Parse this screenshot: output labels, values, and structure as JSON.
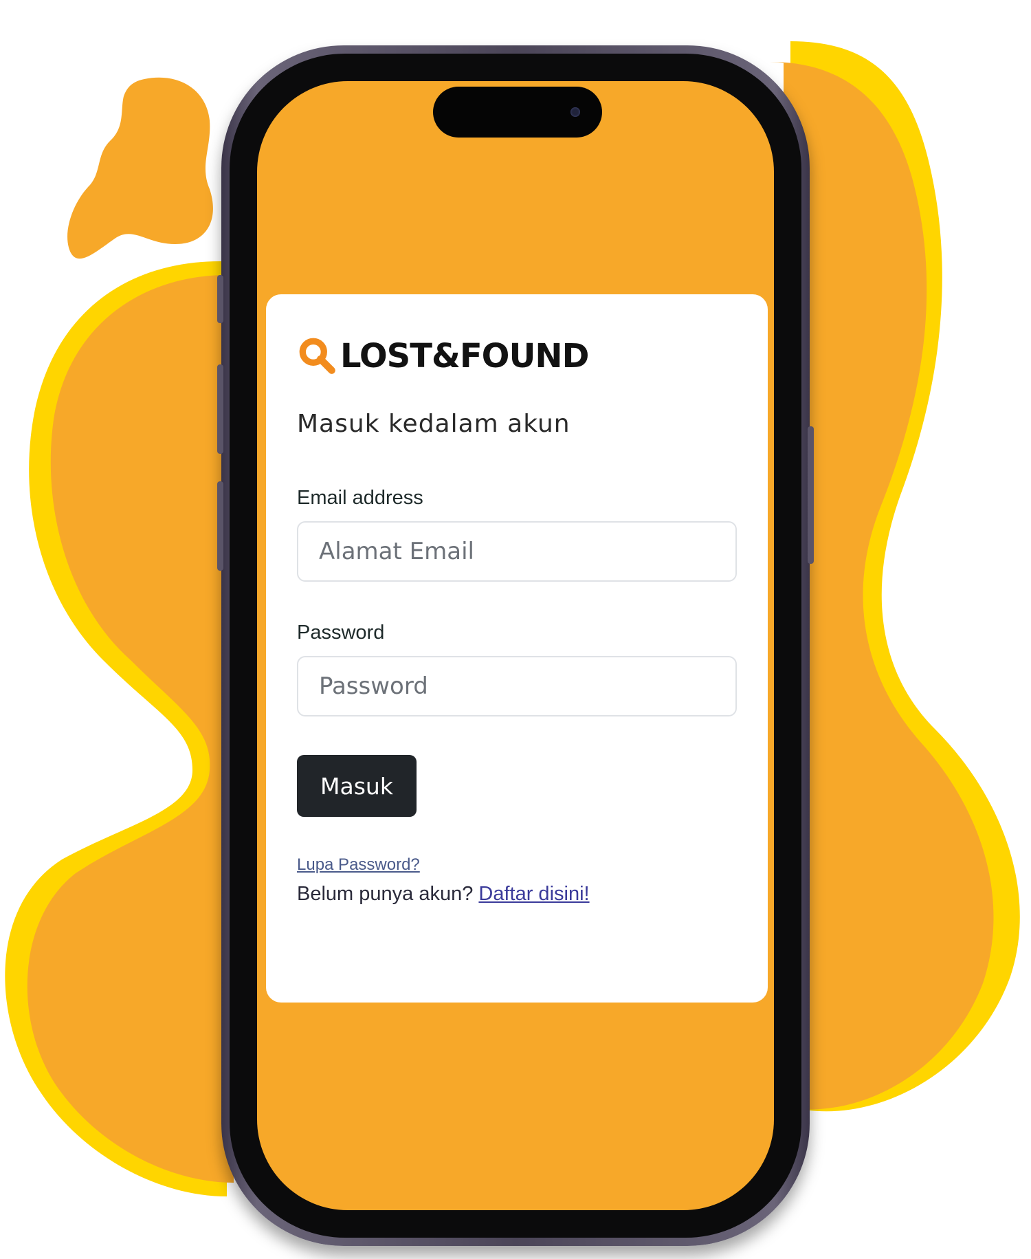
{
  "colors": {
    "screen_background": "#f7a829",
    "blob_orange": "#f7a829",
    "blob_yellow": "#ffd500",
    "button_dark": "#212529",
    "card_background": "#ffffff",
    "brand_icon": "#f28c1e"
  },
  "brand": {
    "name": "LOST&FOUND",
    "icon": "magnifier-icon"
  },
  "login": {
    "heading": "Masuk kedalam akun",
    "email_label": "Email address",
    "email_placeholder": "Alamat Email",
    "password_label": "Password",
    "password_placeholder": "Password",
    "submit_label": "Masuk",
    "forgot_link": "Lupa Password?",
    "signup_prompt": "Belum punya akun?",
    "signup_link": "Daftar disini!"
  }
}
